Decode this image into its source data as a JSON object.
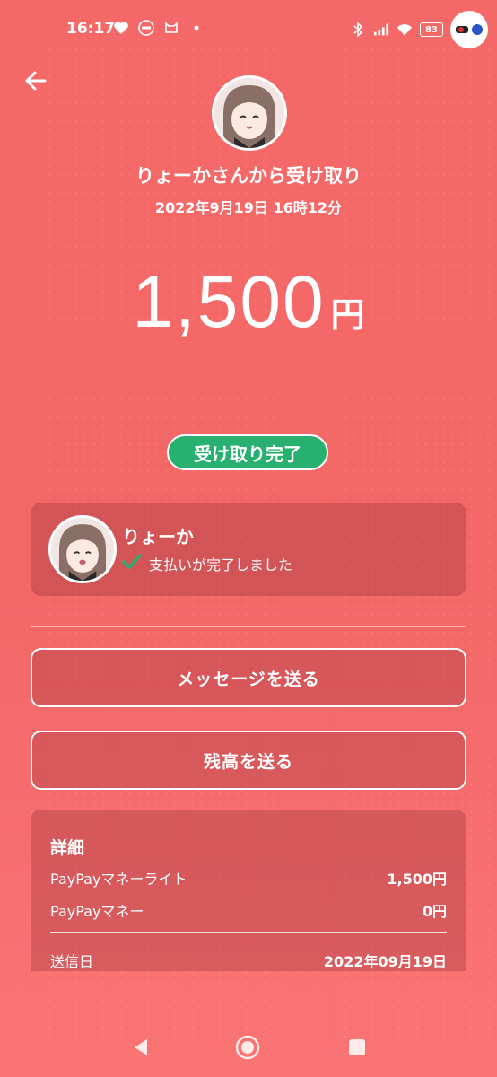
{
  "status_bar": {
    "time": "16:17",
    "battery": "83"
  },
  "header": {
    "title": "りょーかさんから受け取り",
    "datetime": "2022年9月19日 16時12分"
  },
  "amount": {
    "value": "1,500",
    "unit": "円"
  },
  "status_badge": "受け取り完了",
  "sender": {
    "name": "りょーか",
    "status": "支払いが完了しました"
  },
  "actions": {
    "message_label": "メッセージを送る",
    "send_balance_label": "残高を送る"
  },
  "details": {
    "title": "詳細",
    "rows": [
      {
        "label": "PayPayマネーライト",
        "value": "1,500円"
      },
      {
        "label": "PayPayマネー",
        "value": "0円"
      },
      {
        "label": "送信日",
        "value": "2022年09月19日"
      }
    ]
  },
  "colors": {
    "background": "#f46968",
    "badge_green": "#27b070",
    "check_green": "#27b070"
  }
}
